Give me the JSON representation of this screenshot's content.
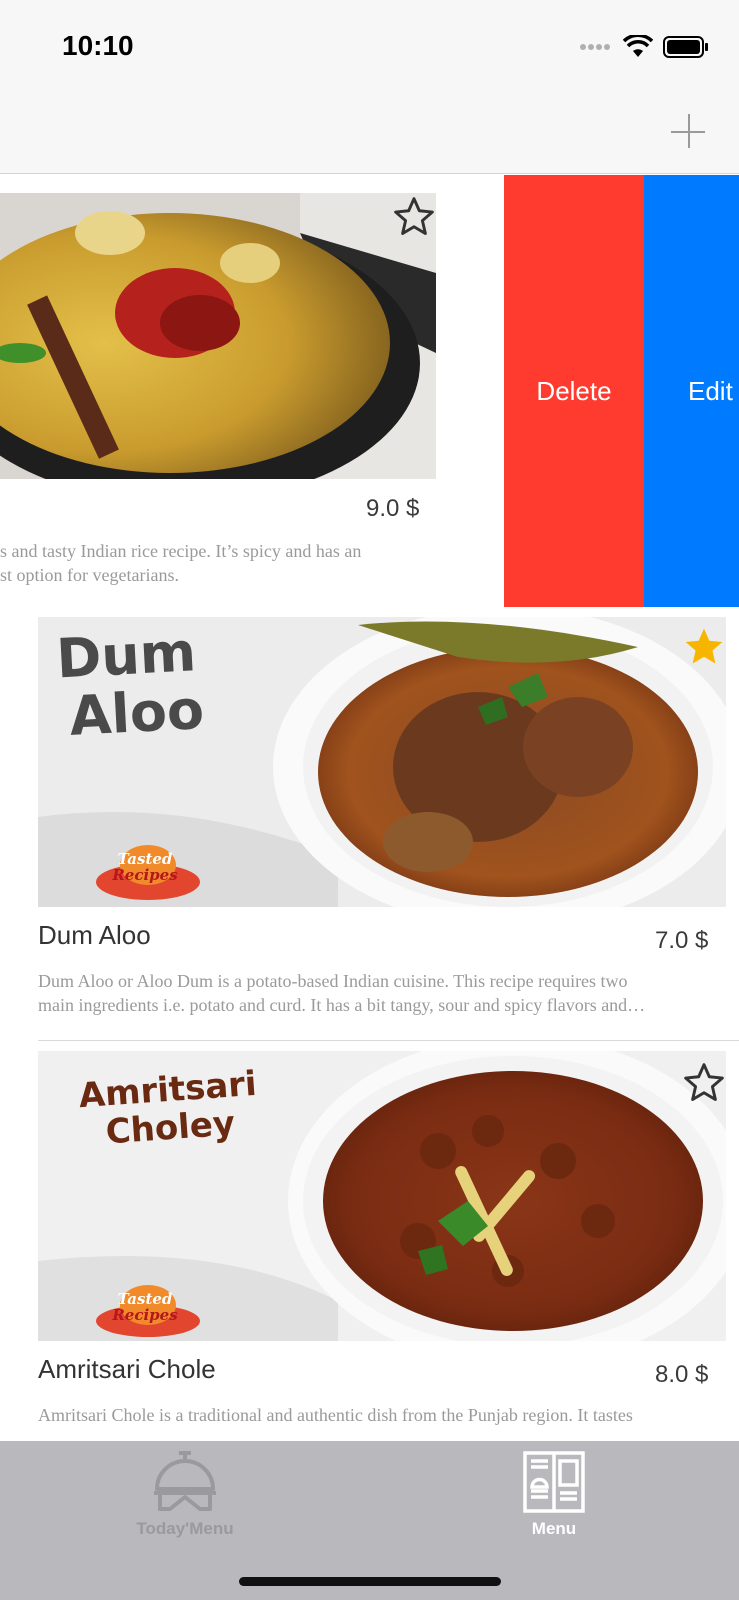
{
  "status_bar": {
    "time": "10:10"
  },
  "nav": {
    "add_icon": "plus-icon"
  },
  "swipe_actions": {
    "delete_label": "Delete",
    "edit_label": "Edit",
    "delete_color": "#ff3b30",
    "edit_color": "#007aff"
  },
  "dishes": [
    {
      "name": "",
      "price": "9.0 $",
      "description": [
        "s and tasty Indian rice recipe. It’s spicy and has an",
        "st option for vegetarians."
      ],
      "favorite": false
    },
    {
      "name": "Dum Aloo",
      "price": "7.0 $",
      "image_text": [
        "Dum",
        "Aloo"
      ],
      "logo_text": [
        "Tasted",
        "Recipes"
      ],
      "description": [
        "Dum Aloo or Aloo Dum is a potato-based Indian cuisine. This recipe requires two",
        "main ingredients i.e. potato and curd. It has a bit tangy, sour and spicy flavors and…"
      ],
      "favorite": true
    },
    {
      "name": "Amritsari Chole",
      "price": "8.0 $",
      "image_text": [
        "Amritsari",
        "Choley"
      ],
      "logo_text": [
        "Tasted",
        "Recipes"
      ],
      "description": [
        "Amritsari Chole is a traditional and authentic dish from the Punjab region. It tastes"
      ],
      "favorite": false
    }
  ],
  "tabs": [
    {
      "label": "Today'Menu",
      "icon": "cloche-icon",
      "active": false
    },
    {
      "label": "Menu",
      "icon": "menu-book-icon",
      "active": true
    }
  ],
  "colors": {
    "favorite_star": "#f7b500",
    "tab_active": "#ffffff",
    "tab_inactive": "#9a9a9e"
  }
}
